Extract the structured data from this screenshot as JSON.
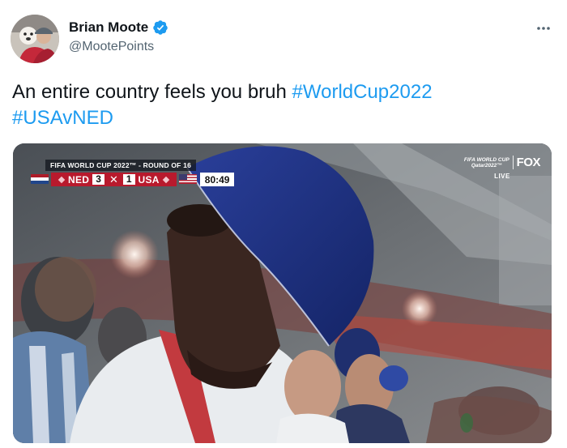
{
  "author": {
    "display_name": "Brian Moote",
    "handle": "@MootePoints",
    "verified": true,
    "verified_color": "#1d9bf0"
  },
  "tweet": {
    "text": "An entire country feels you bruh",
    "hashtags": [
      "#WorldCup2022",
      "#USAvNED"
    ],
    "link_color": "#1d9bf0"
  },
  "media": {
    "scorebug": {
      "title": "FIFA WORLD CUP 2022™ - ROUND OF 16",
      "home_team": "NED",
      "home_score": "3",
      "away_team": "USA",
      "away_score": "1",
      "clock": "80:49",
      "bar_color": "#b81a2d"
    },
    "broadcaster": {
      "event_line1": "FIFA WORLD CUP",
      "event_line2": "Qatar2022™",
      "network": "FOX",
      "status": "LIVE"
    }
  },
  "icons": {
    "verified": "verified-badge-icon",
    "more": "more-options-icon"
  }
}
